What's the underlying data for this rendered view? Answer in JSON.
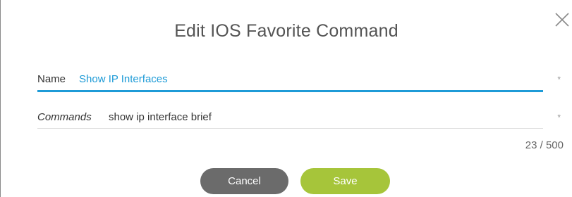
{
  "dialog": {
    "title": "Edit IOS Favorite Command",
    "close_icon": "close-icon"
  },
  "name_field": {
    "label": "Name",
    "value": "Show IP Interfaces",
    "required_marker": "*"
  },
  "commands_field": {
    "label": "Commands",
    "value": "show ip interface brief",
    "required_marker": "*",
    "counter": "23 / 500"
  },
  "buttons": {
    "cancel_label": "Cancel",
    "save_label": "Save"
  },
  "colors": {
    "accent": "#1e9bd7",
    "save": "#a6c53a",
    "cancel": "#6b6b6b"
  }
}
